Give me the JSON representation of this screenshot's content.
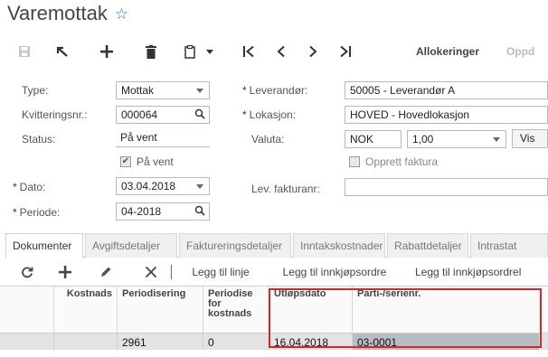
{
  "page": {
    "title": "Varemottak"
  },
  "toolbar": {
    "allokeringer": "Allokeringer",
    "oppd": "Oppd"
  },
  "form": {
    "type_label": "Type:",
    "type_value": "Mottak",
    "kvittering_label": "Kvitteringsnr.:",
    "kvittering_value": "000064",
    "status_label": "Status:",
    "status_value": "På vent",
    "pa_vent_label": "På vent",
    "dato_label": "Dato:",
    "dato_value": "03.04.2018",
    "periode_label": "Periode:",
    "periode_value": "04-2018",
    "leverandor_label": "Leverandør:",
    "leverandor_value": "50005 - Leverandør A",
    "lokasjon_label": "Lokasjon:",
    "lokasjon_value": "HOVED - Hovedlokasjon",
    "valuta_label": "Valuta:",
    "valuta_value": "NOK",
    "kurs_value": "1,00",
    "vis_label": "Vis",
    "opprett_faktura_label": "Opprett faktura",
    "lev_fakturanr_label": "Lev. fakturanr:",
    "lev_fakturanr_value": ""
  },
  "tabs": [
    "Dokumenter",
    "Avgiftsdetaljer",
    "Faktureringsdetaljer",
    "Inntakskostnader",
    "Rabattdetaljer",
    "Intrastat"
  ],
  "gridbar": {
    "legg_til_linje": "Legg til linje",
    "legg_til_innkjopsordre": "Legg til innkjøpsordre",
    "legg_til_innkjopsordrelinje": "Legg til innkjøpsordrel"
  },
  "grid": {
    "headers": [
      "Kostnads",
      "Periodisering",
      "Periodise for kostnads",
      "Utløpsdato",
      "Parti-/serienr."
    ],
    "row": [
      "",
      "2961",
      "0",
      "16.04.2018",
      "03-0001"
    ]
  }
}
